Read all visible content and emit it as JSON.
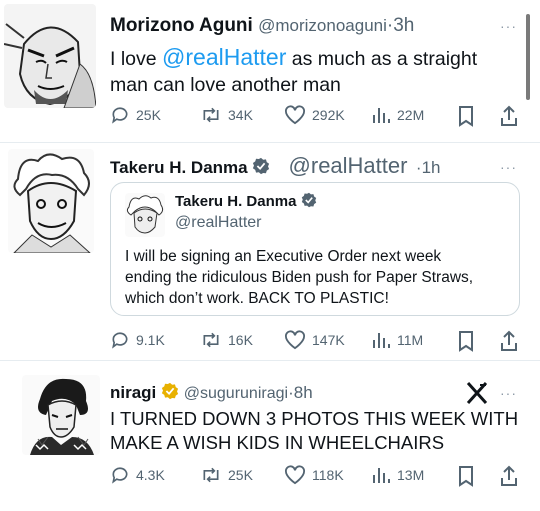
{
  "colors": {
    "accent": "#1d9bf0",
    "muted": "#536471",
    "gold": "#e8b100",
    "text": "#0f1419"
  },
  "tweets": [
    {
      "name": "Morizono Aguni",
      "handle": "@morizonoaguni",
      "sep": "·",
      "time": "3h",
      "more": "···",
      "text_prefix": "I love ",
      "mention": "@realHatter",
      "text_suffix": " as much as a straight",
      "text_line2": "man can love another man",
      "avatar_icon": "manga-portrait-avatar",
      "metrics": {
        "replies": "25K",
        "retweets": "34K",
        "likes": "292K",
        "views": "22M"
      }
    },
    {
      "name": "Takeru H. Danma",
      "verified_icon": "blue-verified-badge",
      "overlay_mention": "@realHatter",
      "sep": "·",
      "time": "1h",
      "more": "···",
      "avatar_icon": "manga-portrait-avatar",
      "quote": {
        "name": "Takeru H. Danma",
        "handle": "@realHatter",
        "lines": [
          "I will be signing an Executive Order next week",
          "ending the ridiculous Biden push for Paper Straws,",
          "which don’t work. BACK TO PLASTIC!"
        ]
      },
      "metrics": {
        "replies": "9.1K",
        "retweets": "16K",
        "likes": "147K",
        "views": "11M"
      }
    },
    {
      "name": "niragi",
      "verified_icon": "gold-verified-badge",
      "handle": "@suguruniragi",
      "sep": "·",
      "time": "8h",
      "more": "···",
      "brand_icon": "x-logo-icon",
      "avatar_icon": "manga-portrait-avatar",
      "lines": [
        "I TURNED DOWN 3 PHOTOS THIS WEEK WITH",
        "MAKE A WISH KIDS IN WHEELCHAIRS"
      ],
      "metrics": {
        "replies": "4.3K",
        "retweets": "25K",
        "likes": "118K",
        "views": "13M"
      }
    }
  ]
}
